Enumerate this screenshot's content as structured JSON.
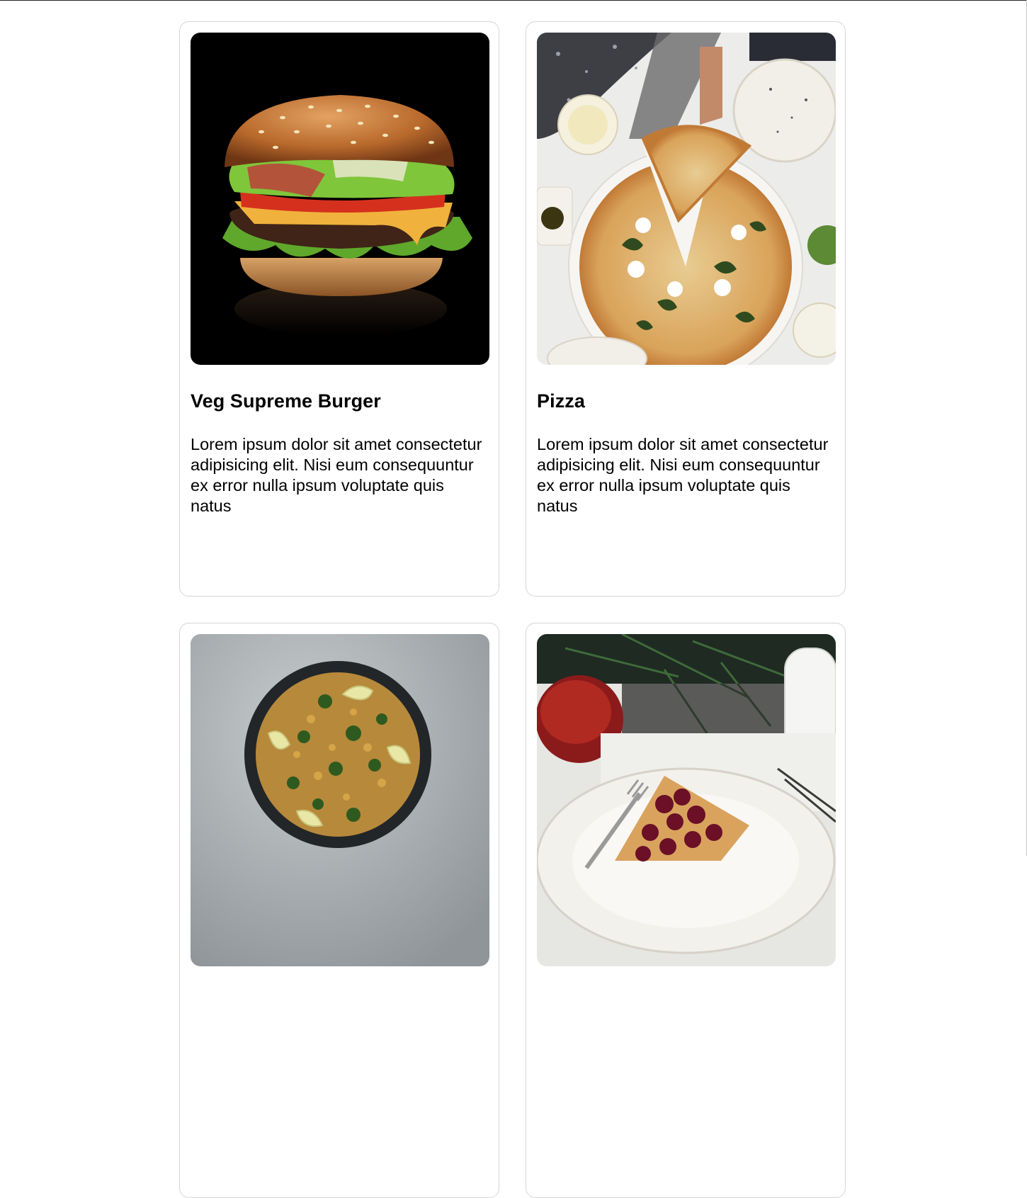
{
  "cards": [
    {
      "title": "Veg Supreme Burger",
      "description": "Lorem ipsum dolor sit amet consectetur adipisicing elit. Nisi eum consequuntur ex error nulla ipsum voluptate quis natus",
      "image": "burger-photo"
    },
    {
      "title": "Pizza",
      "description": "Lorem ipsum dolor sit amet consectetur adipisicing elit. Nisi eum consequuntur ex error nulla ipsum voluptate quis natus",
      "image": "pizza-photo"
    },
    {
      "image": "paella-photo"
    },
    {
      "image": "cherry-pie-photo"
    }
  ]
}
